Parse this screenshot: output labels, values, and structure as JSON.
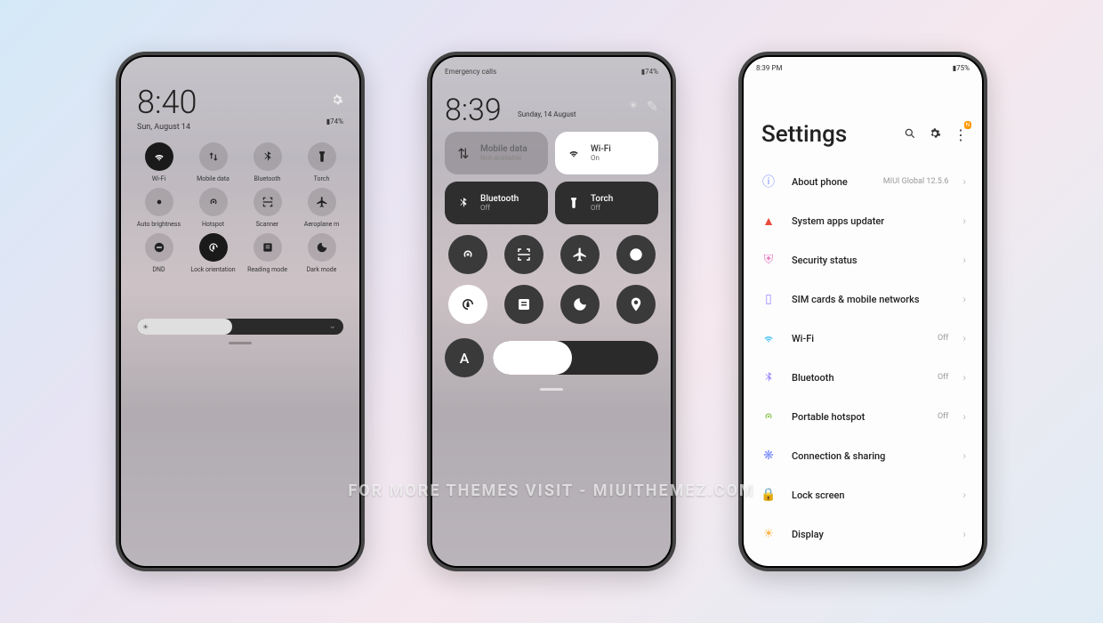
{
  "watermark": "FOR MORE THEMES VISIT - MIUITHEMEZ.COM",
  "phone1": {
    "time": "8:40",
    "date": "Sun, August 14",
    "battery": "74%",
    "tiles": [
      {
        "label": "Wi-Fi",
        "on": true,
        "icon": "wifi"
      },
      {
        "label": "Mobile data",
        "on": false,
        "icon": "data"
      },
      {
        "label": "Bluetooth",
        "on": false,
        "icon": "bluetooth"
      },
      {
        "label": "Torch",
        "on": false,
        "icon": "torch"
      },
      {
        "label": "Auto brightness",
        "on": false,
        "icon": "autobright"
      },
      {
        "label": "Hotspot",
        "on": false,
        "icon": "hotspot"
      },
      {
        "label": "Scanner",
        "on": false,
        "icon": "scanner"
      },
      {
        "label": "Aeroplane m",
        "on": false,
        "icon": "airplane"
      },
      {
        "label": "DND",
        "on": false,
        "icon": "dnd"
      },
      {
        "label": "Lock orientation",
        "on": true,
        "icon": "lock-orient"
      },
      {
        "label": "Reading mode",
        "on": false,
        "icon": "reading"
      },
      {
        "label": "Dark mode",
        "on": false,
        "icon": "darkmode"
      }
    ],
    "brightness_pct": 46
  },
  "phone2": {
    "emergency": "Emergency calls",
    "battery": "74%",
    "time": "8:39",
    "date": "Sunday, 14 August",
    "mobile_data": {
      "title": "Mobile data",
      "sub": "Not available"
    },
    "wifi": {
      "title": "Wi-Fi",
      "sub": "On"
    },
    "bluetooth": {
      "title": "Bluetooth",
      "sub": "Off"
    },
    "torch": {
      "title": "Torch",
      "sub": "Off"
    },
    "grid_icons": [
      "hotspot",
      "scanner",
      "airplane",
      "dnd",
      "lock-orient",
      "reading",
      "darkmode",
      "location"
    ],
    "auto_label": "A",
    "brightness_pct": 48
  },
  "phone3": {
    "status_time": "8:39 PM",
    "status_battery": "75%",
    "title": "Settings",
    "items": [
      {
        "icon": "info",
        "color": "#7b8cff",
        "label": "About phone",
        "value": "MIUI Global 12.5.6"
      },
      {
        "icon": "warning",
        "color": "#e74c3c",
        "label": "System apps updater",
        "value": ""
      },
      {
        "icon": "shield",
        "color": "#e879c0",
        "label": "Security status",
        "value": ""
      },
      {
        "icon": "sim",
        "color": "#9b8cff",
        "label": "SIM cards & mobile networks",
        "value": ""
      },
      {
        "icon": "wifi",
        "color": "#5ac8fa",
        "label": "Wi-Fi",
        "value": "Off"
      },
      {
        "icon": "bluetooth",
        "color": "#9b8cff",
        "label": "Bluetooth",
        "value": "Off"
      },
      {
        "icon": "hotspot",
        "color": "#8bc34a",
        "label": "Portable hotspot",
        "value": "Off"
      },
      {
        "icon": "share",
        "color": "#7b8cff",
        "label": "Connection & sharing",
        "value": ""
      },
      {
        "icon": "lock",
        "color": "#5ac8fa",
        "label": "Lock screen",
        "value": ""
      },
      {
        "icon": "display",
        "color": "#ffb74d",
        "label": "Display",
        "value": ""
      }
    ]
  }
}
